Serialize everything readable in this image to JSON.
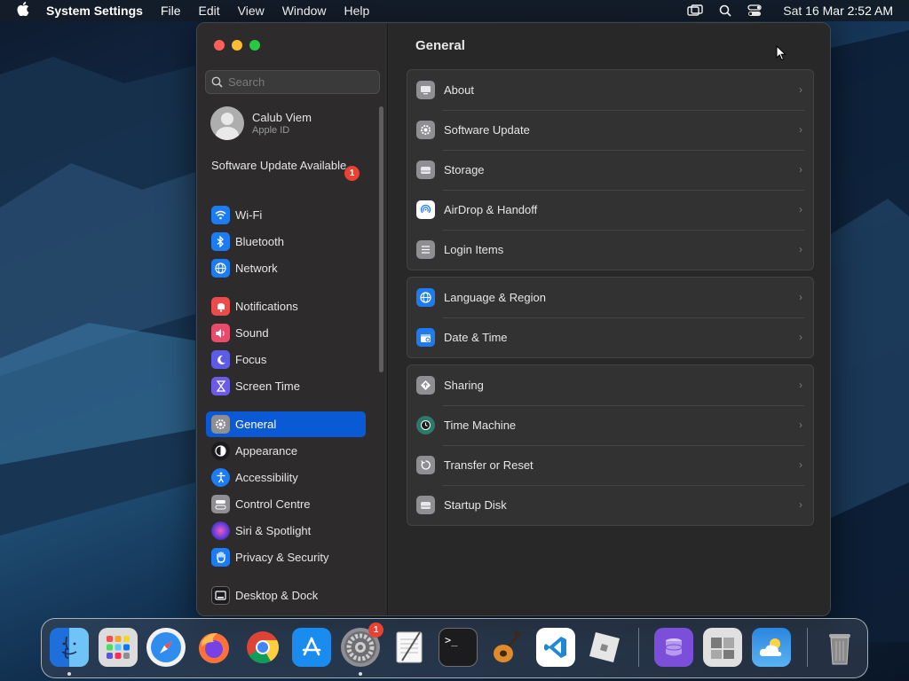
{
  "menubar": {
    "app_name": "System Settings",
    "menus": [
      "File",
      "Edit",
      "View",
      "Window",
      "Help"
    ],
    "clock": "Sat 16 Mar  2:52 AM"
  },
  "sidebar": {
    "search_placeholder": "Search",
    "account": {
      "name": "Calub Viem",
      "subtitle": "Apple ID"
    },
    "update_notice": "Software Update Available",
    "update_badge": "1",
    "items": [
      {
        "label": "Wi-Fi",
        "icon": "wifi-icon",
        "color": "#1e7cf2"
      },
      {
        "label": "Bluetooth",
        "icon": "bluetooth-icon",
        "color": "#1e7cf2"
      },
      {
        "label": "Network",
        "icon": "globe-icon",
        "color": "#1e7cf2"
      },
      {
        "label": "Notifications",
        "icon": "bell-icon",
        "color": "#ea4b4b"
      },
      {
        "label": "Sound",
        "icon": "speaker-icon",
        "color": "#ea4b6c"
      },
      {
        "label": "Focus",
        "icon": "moon-icon",
        "color": "#5e5ce6"
      },
      {
        "label": "Screen Time",
        "icon": "hourglass-icon",
        "color": "#6a5ce6"
      },
      {
        "label": "General",
        "icon": "gear-icon",
        "color": "#8e8e93"
      },
      {
        "label": "Appearance",
        "icon": "appearance-icon",
        "color": "#1c1c1e"
      },
      {
        "label": "Accessibility",
        "icon": "accessibility-icon",
        "color": "#1e7cf2"
      },
      {
        "label": "Control Centre",
        "icon": "control-centre-icon",
        "color": "#8e8e93"
      },
      {
        "label": "Siri & Spotlight",
        "icon": "siri-icon",
        "color": "#b03ad6"
      },
      {
        "label": "Privacy & Security",
        "icon": "hand-icon",
        "color": "#1e7cf2"
      },
      {
        "label": "Desktop & Dock",
        "icon": "dock-icon",
        "color": "#1c1c1e"
      }
    ],
    "active_item": "General"
  },
  "main": {
    "title": "General",
    "groups": [
      [
        {
          "label": "About",
          "icon": "computer-icon",
          "color": "#8e8e93"
        },
        {
          "label": "Software Update",
          "icon": "gear-badge-icon",
          "color": "#8e8e93"
        },
        {
          "label": "Storage",
          "icon": "drive-icon",
          "color": "#8e8e93"
        },
        {
          "label": "AirDrop & Handoff",
          "icon": "airdrop-icon",
          "color": "#ffffff"
        },
        {
          "label": "Login Items",
          "icon": "list-icon",
          "color": "#8e8e93"
        }
      ],
      [
        {
          "label": "Language & Region",
          "icon": "globe-icon",
          "color": "#1e7cf2"
        },
        {
          "label": "Date & Time",
          "icon": "calendar-icon",
          "color": "#1e7cf2"
        }
      ],
      [
        {
          "label": "Sharing",
          "icon": "sharing-icon",
          "color": "#8e8e93"
        },
        {
          "label": "Time Machine",
          "icon": "time-machine-icon",
          "color": "#2c7a6a"
        },
        {
          "label": "Transfer or Reset",
          "icon": "reset-icon",
          "color": "#8e8e93"
        },
        {
          "label": "Startup Disk",
          "icon": "disk-icon",
          "color": "#8e8e93"
        }
      ]
    ]
  },
  "dock": {
    "apps": [
      {
        "name": "Finder",
        "icon": "finder-icon",
        "color": "#3a8fe8",
        "running": true
      },
      {
        "name": "Launchpad",
        "icon": "launchpad-icon",
        "color": "#d9d9d9",
        "running": false
      },
      {
        "name": "Safari",
        "icon": "safari-icon",
        "color": "#2f8df0",
        "running": false
      },
      {
        "name": "Firefox",
        "icon": "firefox-icon",
        "color": "#ff7139",
        "running": false
      },
      {
        "name": "Chrome",
        "icon": "chrome-icon",
        "color": "#ffffff",
        "running": false
      },
      {
        "name": "App Store",
        "icon": "app-store-icon",
        "color": "#1a8cf0",
        "running": false
      },
      {
        "name": "System Settings",
        "icon": "system-settings-icon",
        "color": "#8e8e93",
        "running": true,
        "badge": "1"
      },
      {
        "name": "TextEdit",
        "icon": "textedit-icon",
        "color": "#f2f2f2",
        "running": false
      },
      {
        "name": "Terminal",
        "icon": "terminal-icon",
        "color": "#1c1c1e",
        "running": false
      },
      {
        "name": "GarageBand",
        "icon": "garageband-icon",
        "color": "#3a2a1a",
        "running": false
      },
      {
        "name": "Visual Studio Code",
        "icon": "vscode-icon",
        "color": "#ffffff",
        "running": false
      },
      {
        "name": "Roblox",
        "icon": "roblox-icon",
        "color": "#e6e6e6",
        "running": false
      },
      {
        "name": "Storage Manager",
        "icon": "storage-app-icon",
        "color": "#7b4fd9",
        "running": false
      },
      {
        "name": "Boot Camp Assistant",
        "icon": "bootcamp-icon",
        "color": "#d0d0d0",
        "running": false
      },
      {
        "name": "Weather",
        "icon": "weather-icon",
        "color": "#2a86e0",
        "running": false
      },
      {
        "name": "Trash",
        "icon": "trash-icon",
        "color": "#9a9a9a",
        "running": false
      }
    ]
  }
}
